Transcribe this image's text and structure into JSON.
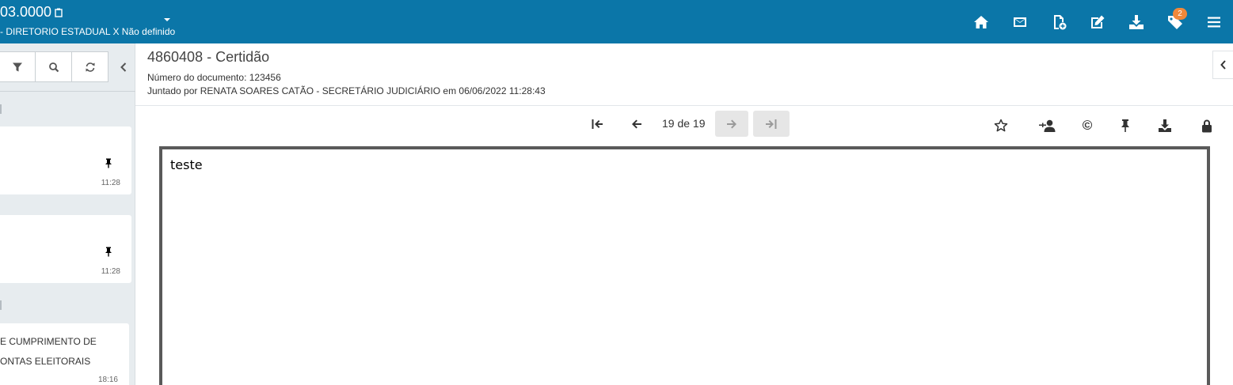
{
  "header": {
    "process_number": "03.0000",
    "parties": "- DIRETORIO ESTADUAL X Não definido",
    "notification_count": "2",
    "icons": [
      "home-icon",
      "envelope-icon",
      "file-add-icon",
      "edit-icon",
      "download-icon",
      "tags-icon",
      "menu-icon"
    ]
  },
  "left_panel": {
    "toolbar": [
      "filter-icon",
      "search-icon",
      "refresh-icon"
    ],
    "cards": [
      {
        "time": "11:28"
      },
      {
        "time": "11:28"
      },
      {
        "line1": "E CUMPRIMENTO DE",
        "line2": "ONTAS ELEITORAIS",
        "time": "18:16"
      }
    ]
  },
  "document": {
    "title": "4860408 - Certidão",
    "number_line": "Número do documento: 123456",
    "joined_line": "Juntado por RENATA SOARES CATÃO - SECRETÁRIO JUDICIÁRIO em 06/06/2022 11:28:43",
    "page_indicator": "19 de 19",
    "content": "teste",
    "copyright_symbol": "©"
  },
  "colors": {
    "topbar": "#0b76a8",
    "badge": "#f0883a",
    "panel_bg": "#e7ecef"
  }
}
